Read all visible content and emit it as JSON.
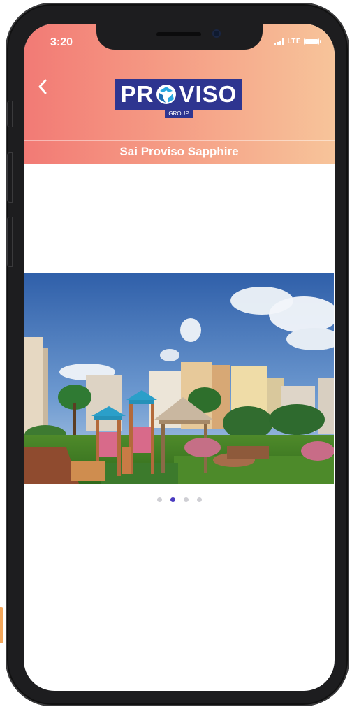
{
  "status_bar": {
    "time": "3:20",
    "network": "LTE"
  },
  "header": {
    "logo": {
      "brand": "PROVISO",
      "sub": "GROUP"
    },
    "title": "Sai Proviso Sapphire"
  },
  "carousel": {
    "image_alt": "Rendering of residential towers with children's play area and gazebo garden",
    "dots": [
      {
        "active": false
      },
      {
        "active": true
      },
      {
        "active": false
      },
      {
        "active": false
      }
    ],
    "active_index": 1
  },
  "colors": {
    "header_gradient_start": "#f27a75",
    "header_gradient_end": "#f7c49a",
    "logo_navy": "#2e3590",
    "active_dot": "#4b3cc0",
    "inactive_dot": "#cfcfd4"
  },
  "icons": [
    "back-chevron-icon",
    "signal-icon",
    "battery-icon"
  ]
}
